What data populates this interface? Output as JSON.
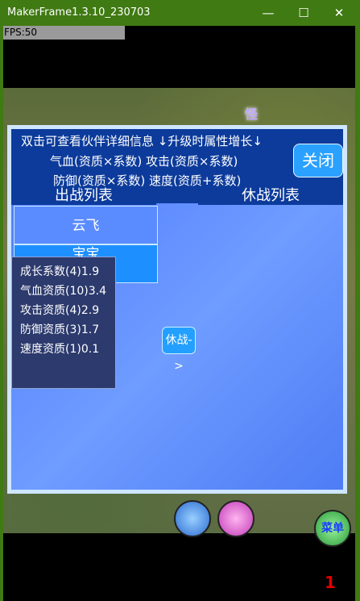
{
  "window": {
    "title": "MakerFrame1.3.10_230703"
  },
  "fps": "FPS:50",
  "scene": {
    "monster_label": "怪",
    "counter": "1",
    "menu_button": "菜单"
  },
  "dialog": {
    "header_lines": [
      "双击可查看伙伴详细信息 ↓升级时属性增长↓",
      "气血(资质×系数) 攻击(资质×系数)",
      "防御(资质×系数) 速度(资质+系数)"
    ],
    "close_label": "关闭",
    "tabs": {
      "active": "出战列表",
      "inactive": "休战列表"
    },
    "list": [
      "云飞",
      "宝宝"
    ],
    "rest_button": "休战->",
    "tooltip": [
      "成长系数(4)1.9",
      "气血资质(10)3.4",
      "攻击资质(4)2.9",
      "防御资质(3)1.7",
      "速度资质(1)0.1"
    ]
  }
}
